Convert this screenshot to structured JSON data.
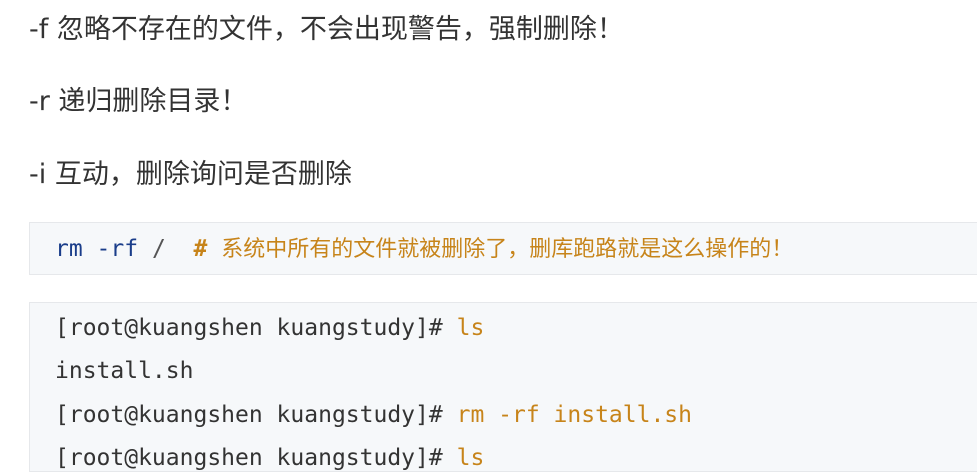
{
  "paragraphs": {
    "p1": "-f 忽略不存在的文件，不会出现警告，强制删除！",
    "p2": "-r 递归删除目录！",
    "p3": "-i 互动，删除询问是否删除"
  },
  "code1": {
    "cmd": "rm -rf",
    "slash": "/",
    "hash": "#",
    "comment": "系统中所有的文件就被删除了，删库跑路就是这么操作的！"
  },
  "code2": {
    "lines": [
      {
        "prompt": "[root@kuangshen kuangstudy]#",
        "input": "ls",
        "output": ""
      },
      {
        "prompt": "",
        "input": "",
        "output": "install.sh"
      },
      {
        "prompt": "[root@kuangshen kuangstudy]#",
        "input": "rm -rf install.sh",
        "output": ""
      },
      {
        "prompt": "[root@kuangshen kuangstudy]#",
        "input": "ls",
        "output": ""
      }
    ]
  },
  "colors": {
    "text": "#333333",
    "keyword_blue": "#1a3d8a",
    "comment_orange": "#c7841a",
    "code_background": "#f6f8fa"
  }
}
